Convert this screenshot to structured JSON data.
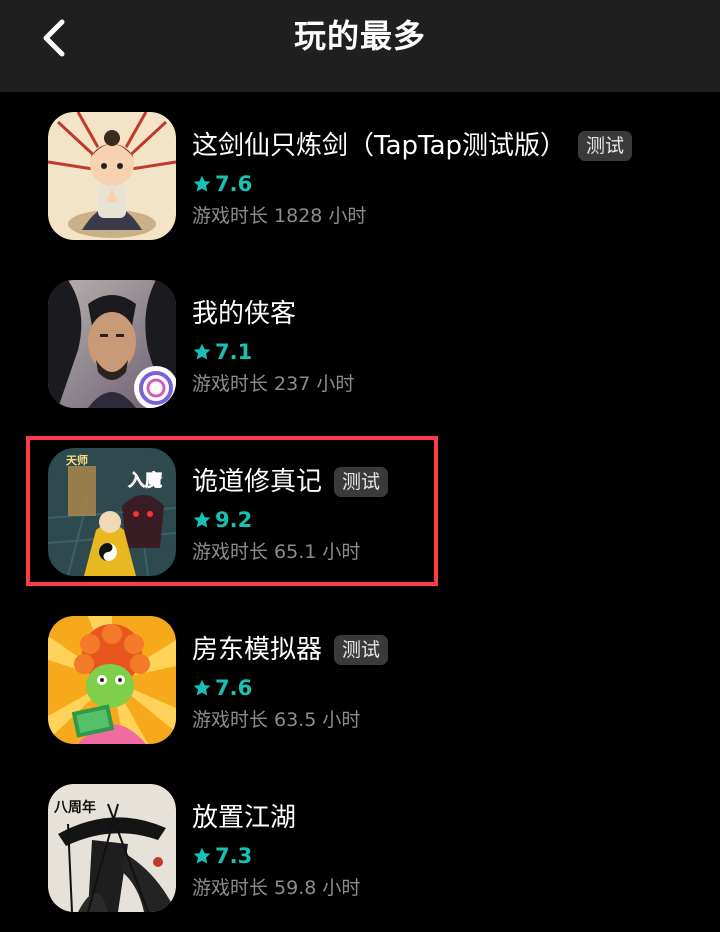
{
  "header": {
    "title": "玩的最多",
    "back_icon": "chevron-left-icon"
  },
  "games": [
    {
      "name": "这剑仙只炼剑（TapTap测试版）",
      "badge": "测试",
      "rating": "7.6",
      "playtime": "游戏时长 1828 小时",
      "icon": "cultivator-boy-icon"
    },
    {
      "name": "我的侠客",
      "badge": "",
      "rating": "7.1",
      "playtime": "游戏时长 237 小时",
      "icon": "swordsman-portrait-icon"
    },
    {
      "name": "诡道修真记",
      "badge": "测试",
      "rating": "9.2",
      "playtime": "游戏时长 65.1 小时",
      "icon": "taoist-demon-icon",
      "icon_text_left": "天师",
      "icon_text_right": "入魔"
    },
    {
      "name": "房东模拟器",
      "badge": "测试",
      "rating": "7.6",
      "playtime": "游戏时长 63.5 小时",
      "icon": "landlord-money-icon"
    },
    {
      "name": "放置江湖",
      "badge": "",
      "rating": "7.3",
      "playtime": "游戏时长 59.8 小时",
      "icon": "ink-swordsman-icon",
      "icon_text": "八周年"
    }
  ],
  "colors": {
    "rating": "#17c1b4",
    "highlight": "#ff3b47",
    "header_bg": "#1f1f1f"
  }
}
